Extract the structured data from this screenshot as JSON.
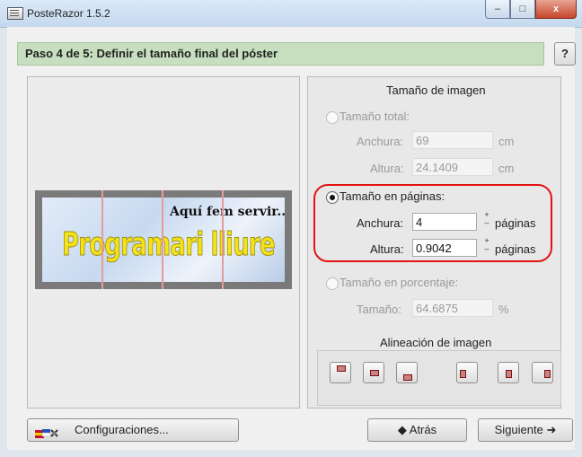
{
  "window": {
    "title": "PosteRazor 1.5.2",
    "min_label": "–",
    "max_label": "□",
    "close_label": "x"
  },
  "step": {
    "title": "Paso 4 de 5: Definir el tamaño final del póster",
    "help_label": "?"
  },
  "preview": {
    "poster_tagline": "Aquí fem servir...",
    "poster_title": "Programari lliure"
  },
  "image_size": {
    "title": "Tamaño de imagen",
    "total": {
      "label": "Tamaño total:",
      "width_label": "Anchura:",
      "width_value": "69",
      "width_unit": "cm",
      "height_label": "Altura:",
      "height_value": "24.1409",
      "height_unit": "cm"
    },
    "pages": {
      "label": "Tamaño en páginas:",
      "width_label": "Anchura:",
      "width_value": "4",
      "width_unit": "páginas",
      "height_label": "Altura:",
      "height_value": "0.9042",
      "height_unit": "páginas",
      "spin_up": "+",
      "spin_down": "–"
    },
    "percent": {
      "label": "Tamaño en porcentaje:",
      "size_label": "Tamaño:",
      "size_value": "64.6875",
      "size_unit": "%"
    },
    "selected": "pages"
  },
  "alignment": {
    "title": "Alineación de imagen"
  },
  "footer": {
    "settings_label": "Configuraciones...",
    "back_label": "◆ Atrás",
    "next_label": "Siguiente ➜"
  },
  "colors": {
    "highlight": "#e21414",
    "step_header": "#c7dfbf"
  }
}
